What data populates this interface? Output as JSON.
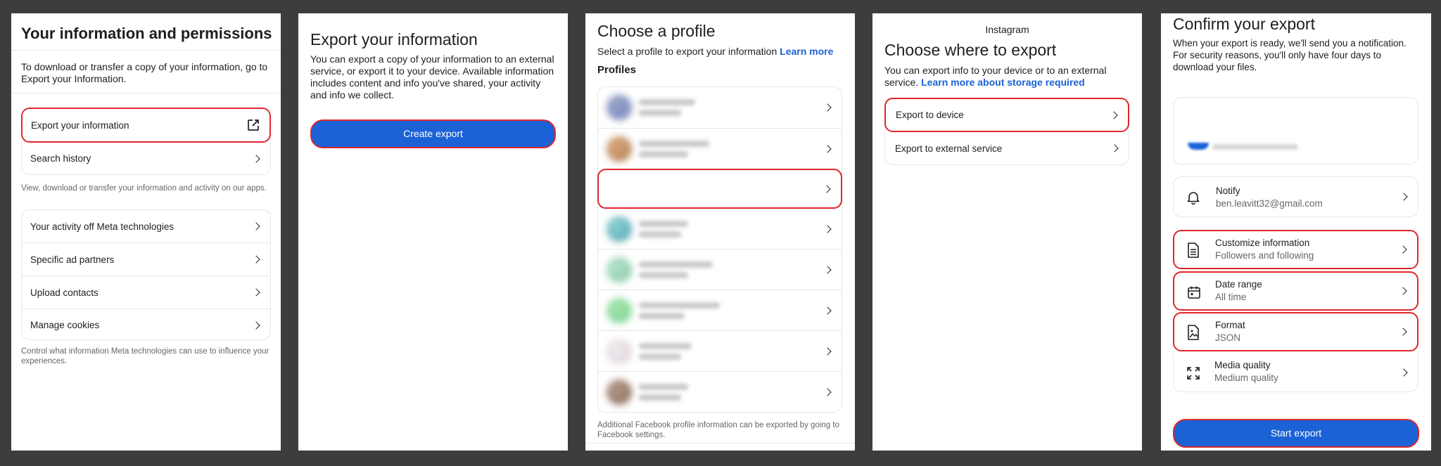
{
  "panel1": {
    "title": "Your information and permissions",
    "intro": "To download or transfer a copy of your information, go to Export your Information.",
    "export_item": "Export your information",
    "search_history": "Search history",
    "caption1": "View, download or transfer your information and activity on our apps.",
    "items": [
      "Your activity off Meta technologies",
      "Specific ad partners",
      "Upload contacts",
      "Manage cookies"
    ],
    "caption2": "Control what information Meta technologies can use to influence your experiences."
  },
  "panel2": {
    "title": "Export your information",
    "description": "You can export a copy of your information to an external service, or export it to your device. Available information includes content and info you've shared, your activity and info we collect.",
    "button": "Create export"
  },
  "panel3": {
    "title": "Choose a profile",
    "subtitle": "Select a profile to export your information",
    "learn_more": "Learn more",
    "section": "Profiles",
    "footer": "Additional Facebook profile information can be exported by going to Facebook settings."
  },
  "panel4": {
    "app_name": "Instagram",
    "title": "Choose where to export",
    "description": "You can export info to your device or to an external service.",
    "learn_more": "Learn more about storage required",
    "option1": "Export to device",
    "option2": "Export to external service"
  },
  "panel5": {
    "title": "Confirm your export",
    "description": "When your export is ready, we'll send you a notification. For security reasons, you'll only have four days to download your files.",
    "options": [
      {
        "label": "Notify",
        "value": "ben.leavitt32@gmail.com",
        "icon": "bell-icon"
      },
      {
        "label": "Customize information",
        "value": "Followers and following",
        "icon": "document-icon"
      },
      {
        "label": "Date range",
        "value": "All time",
        "icon": "calendar-icon"
      },
      {
        "label": "Format",
        "value": "JSON",
        "icon": "file-image-icon"
      },
      {
        "label": "Media quality",
        "value": "Medium quality",
        "icon": "expand-arrows-icon"
      }
    ],
    "button": "Start export"
  },
  "colors": {
    "background": "#3d3d3d",
    "accent_blue": "#1a62d6",
    "highlight_red": "#e0262b"
  }
}
